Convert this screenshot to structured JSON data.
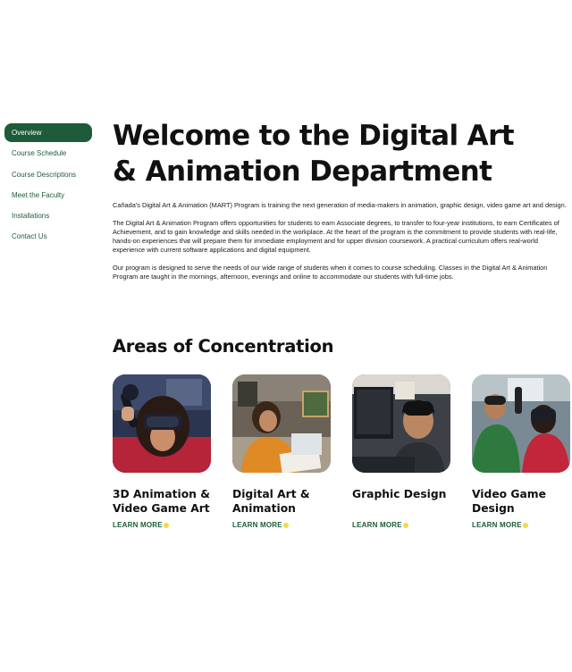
{
  "sidebar": {
    "items": [
      {
        "label": "Overview",
        "active": true
      },
      {
        "label": "Course Schedule"
      },
      {
        "label": "Course Descriptions"
      },
      {
        "label": "Meet the Faculty"
      },
      {
        "label": "Installations"
      },
      {
        "label": "Contact Us"
      }
    ]
  },
  "main": {
    "title_line1": "Welcome to the Digital Art",
    "title_line2": "& Animation Department",
    "paragraphs": [
      "Cañada's Digital Art & Animation (MART) Program is training the next generation of media-makers in animation, graphic design, video game art and design.",
      "The Digital Art & Animation Program offers opportunities for students to earn Associate degrees, to transfer to four-year institutions, to earn Certificates of Achievement, and to gain knowledge and skills needed in the workplace. At the heart of the program is the commitment to provide students with real-life, hands-on experiences that will prepare them for immediate employment and for upper division coursework. A practical curriculum offers real-world experience with current software applications and digital equipment.",
      "Our program is designed to serve the needs of our wide range of students when it comes to course scheduling. Classes in the Digital Art & Animation Program are taught in the mornings, afternoon, evenings and online to accommodate our students with full-time jobs."
    ]
  },
  "areas": {
    "heading": "Areas of Concentration",
    "cards": [
      {
        "title_line1": "3D Animation &",
        "title_line2": "Video Game Art",
        "link": "LEARN MORE"
      },
      {
        "title_line1": "Digital Art &",
        "title_line2": "Animation",
        "link": "LEARN MORE"
      },
      {
        "title_line1": "Graphic Design",
        "title_line2": "",
        "link": "LEARN MORE"
      },
      {
        "title_line1": "Video Game",
        "title_line2": "Design",
        "link": "LEARN MORE"
      }
    ]
  },
  "colors": {
    "accent_green": "#1f5b3a",
    "dot_yellow": "#f2dc3a"
  }
}
